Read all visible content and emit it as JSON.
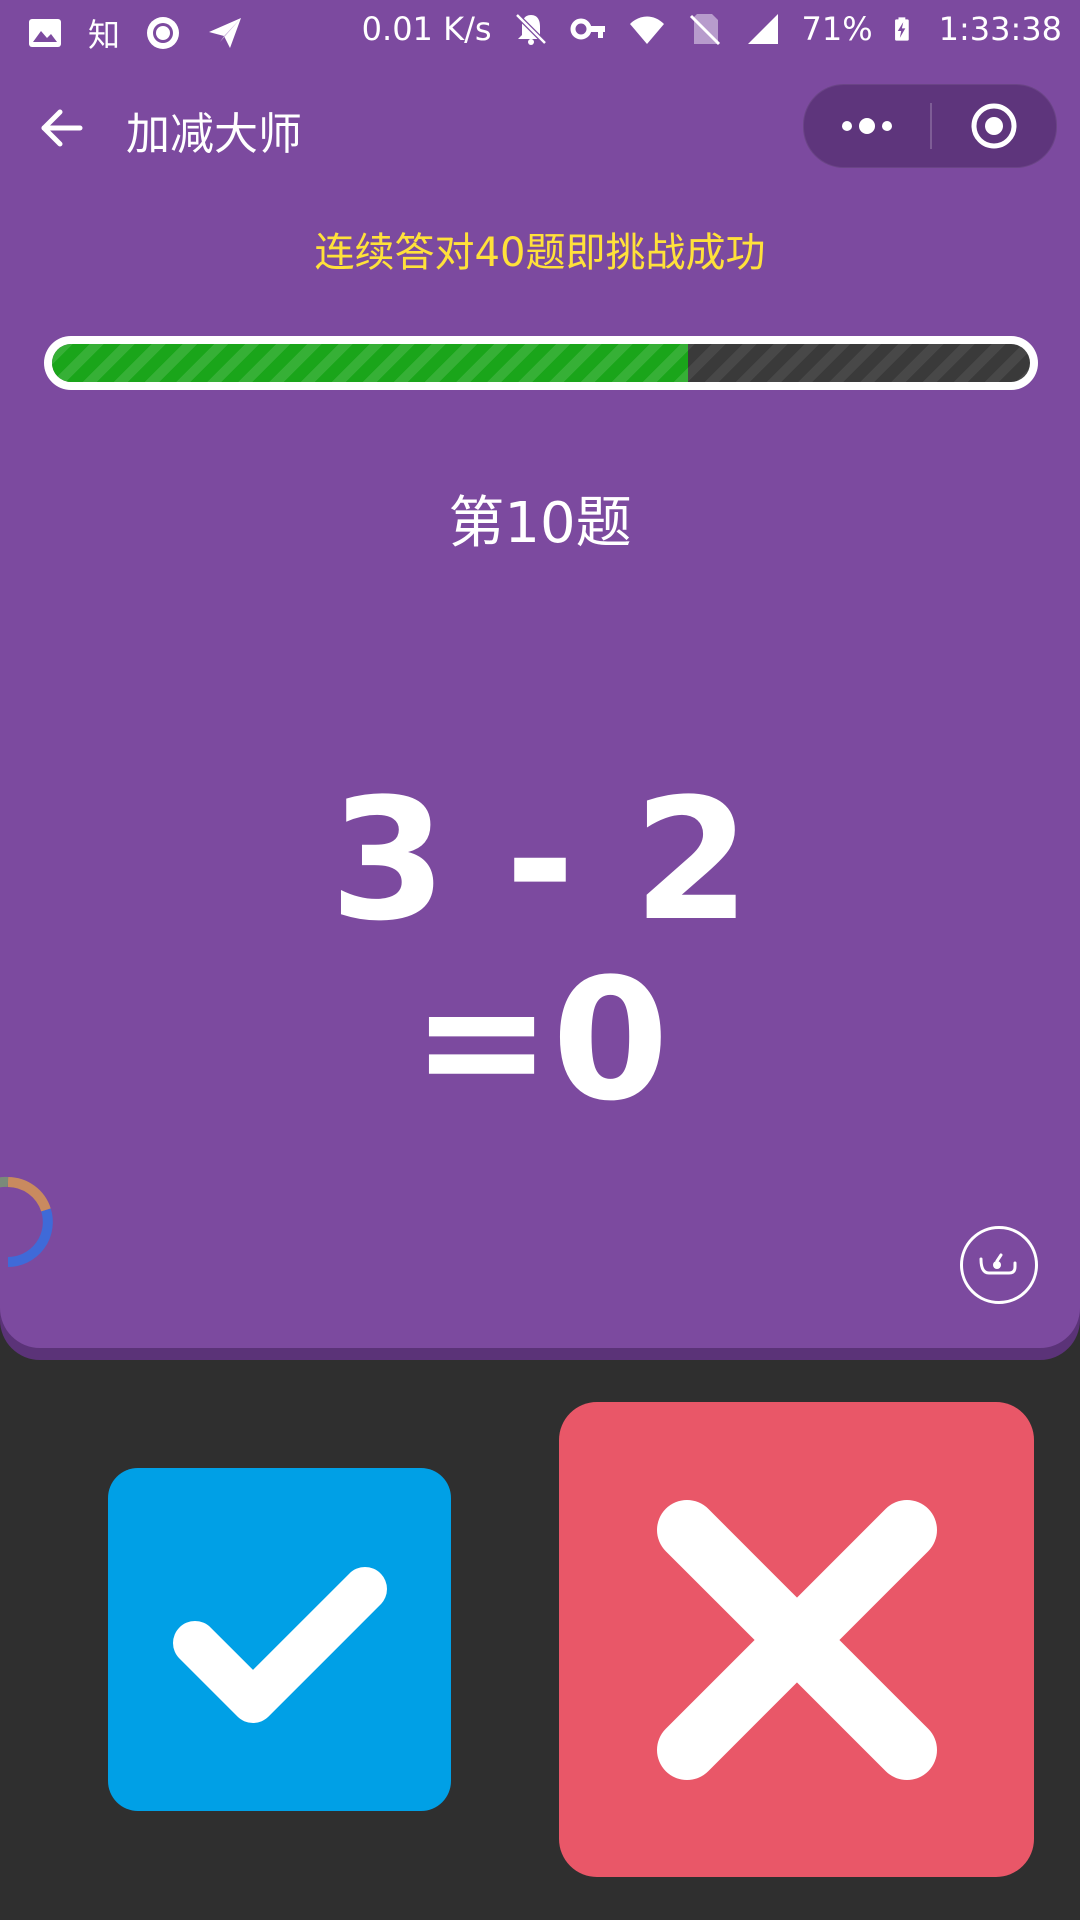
{
  "status_bar": {
    "network_speed": "0.01 K/s",
    "battery": "71%",
    "time": "1:33:38",
    "left_icons": [
      "image-icon",
      "zhihu-icon",
      "circle-app-icon",
      "send-icon"
    ],
    "right_icons": [
      "bell-off-icon",
      "key-icon",
      "wifi-icon",
      "no-sim-icon",
      "signal-icon",
      "battery-charging-icon"
    ],
    "zhihu_label": "知"
  },
  "nav": {
    "title": "加减大师",
    "back_icon": "arrow-left-icon",
    "menu_icon": "more-dots-icon",
    "close_icon": "target-circle-icon"
  },
  "game": {
    "challenge_text": "连续答对40题即挑战成功",
    "progress_percent": 65,
    "question_label": "第10题",
    "expression": "3 - 2",
    "answer": "=0"
  },
  "buttons": {
    "correct_icon": "checkmark-icon",
    "wrong_icon": "cross-icon",
    "sound_icon": "sound-icon"
  },
  "colors": {
    "background_purple": "#7c4a9f",
    "challenge_yellow": "#ffe13a",
    "progress_green": "#1aa51a",
    "correct_blue": "#00a0e6",
    "wrong_red": "#e95768",
    "bottom_dark": "#2f2f2f"
  }
}
